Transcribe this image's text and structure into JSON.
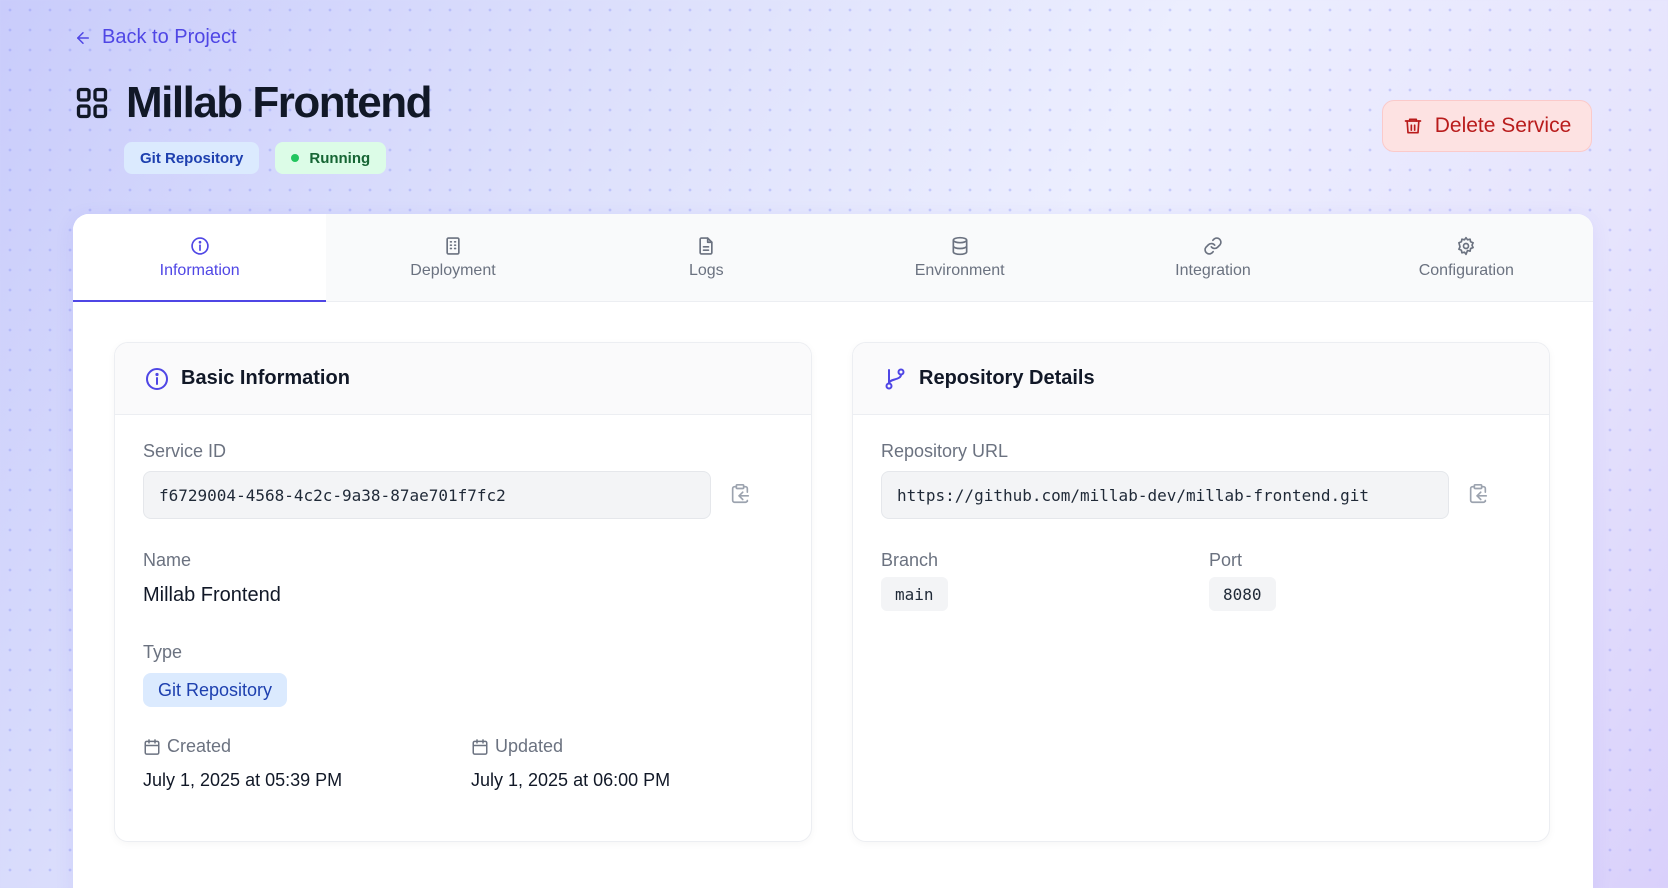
{
  "header": {
    "back_label": "Back to Project",
    "title": "Millab Frontend",
    "type_badge": "Git Repository",
    "status_badge": "Running",
    "delete_label": "Delete Service"
  },
  "tabs": [
    {
      "label": "Information",
      "icon": "info-icon",
      "active": true
    },
    {
      "label": "Deployment",
      "icon": "building-icon",
      "active": false
    },
    {
      "label": "Logs",
      "icon": "file-text-icon",
      "active": false
    },
    {
      "label": "Environment",
      "icon": "database-icon",
      "active": false
    },
    {
      "label": "Integration",
      "icon": "link-icon",
      "active": false
    },
    {
      "label": "Configuration",
      "icon": "gear-icon",
      "active": false
    }
  ],
  "basic_info": {
    "title": "Basic Information",
    "service_id_label": "Service ID",
    "service_id": "f6729004-4568-4c2c-9a38-87ae701f7fc2",
    "name_label": "Name",
    "name": "Millab Frontend",
    "type_label": "Type",
    "type": "Git Repository",
    "created_label": "Created",
    "created": "July 1, 2025 at 05:39 PM",
    "updated_label": "Updated",
    "updated": "July 1, 2025 at 06:00 PM"
  },
  "repo_details": {
    "title": "Repository Details",
    "url_label": "Repository URL",
    "url": "https://github.com/millab-dev/millab-frontend.git",
    "branch_label": "Branch",
    "branch": "main",
    "port_label": "Port",
    "port": "8080"
  },
  "colors": {
    "accent": "#4f46e5",
    "danger": "#b91c1c",
    "success": "#22c55e",
    "info_badge": "#dbeafe"
  }
}
